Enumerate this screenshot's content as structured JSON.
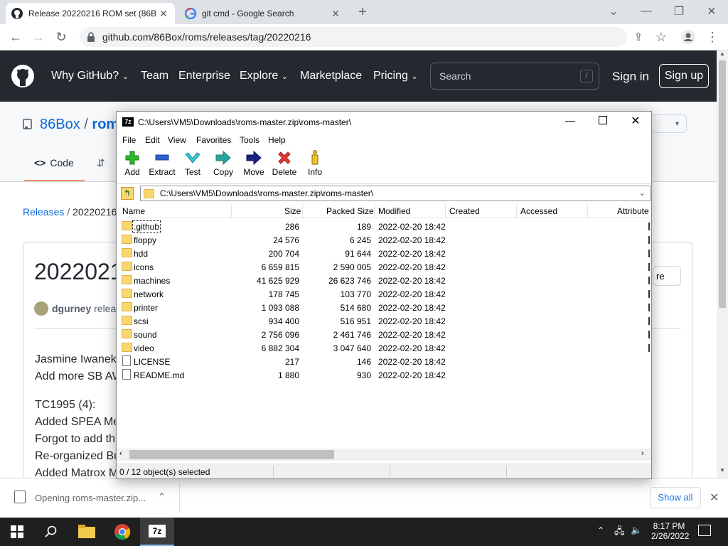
{
  "browser": {
    "tabs": [
      {
        "title": "Release 20220216 ROM set (86B",
        "active": true
      },
      {
        "title": "git cmd - Google Search",
        "active": false
      }
    ],
    "new_tab": "+",
    "url": "github.com/86Box/roms/releases/tag/20220216"
  },
  "github": {
    "nav": [
      "Why GitHub?",
      "Team",
      "Enterprise",
      "Explore",
      "Marketplace",
      "Pricing"
    ],
    "search_placeholder": "Search",
    "search_key": "/",
    "sign_in": "Sign in",
    "sign_up": "Sign up",
    "repo_owner": "86Box",
    "repo_sep": "/",
    "repo_name": "rom",
    "tab_code": "Code",
    "breadcrumb_releases": "Releases",
    "breadcrumb_sep": "/",
    "breadcrumb_tag": "20220216",
    "release_title": "2022021",
    "author": "dgurney",
    "author_suffix": "releas",
    "body_lines": [
      "Jasmine Iwanek",
      "Add more SB AW",
      "TC1995 (4):",
      "Added SPEA Me",
      "Forgot to add th",
      "Re-organized Bu",
      "Added Matrox M"
    ],
    "side_btn": "re"
  },
  "downloads": {
    "item": "Opening roms-master.zip...",
    "show_all": "Show all"
  },
  "taskbar": {
    "time": "8:17 PM",
    "date": "2/26/2022"
  },
  "zip": {
    "title": "C:\\Users\\VM5\\Downloads\\roms-master.zip\\roms-master\\",
    "menu": [
      "File",
      "Edit",
      "View",
      "Favorites",
      "Tools",
      "Help"
    ],
    "tools": [
      "Add",
      "Extract",
      "Test",
      "Copy",
      "Move",
      "Delete",
      "Info"
    ],
    "path": "C:\\Users\\VM5\\Downloads\\roms-master.zip\\roms-master\\",
    "columns": [
      "Name",
      "Size",
      "Packed Size",
      "Modified",
      "Created",
      "Accessed",
      "Attribute"
    ],
    "files": [
      {
        "name": ".github",
        "size": "286",
        "packed": "189",
        "modified": "2022-02-20 18:42",
        "type": "folder"
      },
      {
        "name": "floppy",
        "size": "24 576",
        "packed": "6 245",
        "modified": "2022-02-20 18:42",
        "type": "folder"
      },
      {
        "name": "hdd",
        "size": "200 704",
        "packed": "91 644",
        "modified": "2022-02-20 18:42",
        "type": "folder"
      },
      {
        "name": "icons",
        "size": "6 659 815",
        "packed": "2 590 005",
        "modified": "2022-02-20 18:42",
        "type": "folder"
      },
      {
        "name": "machines",
        "size": "41 625 929",
        "packed": "26 623 746",
        "modified": "2022-02-20 18:42",
        "type": "folder"
      },
      {
        "name": "network",
        "size": "178 745",
        "packed": "103 770",
        "modified": "2022-02-20 18:42",
        "type": "folder"
      },
      {
        "name": "printer",
        "size": "1 093 088",
        "packed": "514 680",
        "modified": "2022-02-20 18:42",
        "type": "folder"
      },
      {
        "name": "scsi",
        "size": "934 400",
        "packed": "516 951",
        "modified": "2022-02-20 18:42",
        "type": "folder"
      },
      {
        "name": "sound",
        "size": "2 756 096",
        "packed": "2 461 746",
        "modified": "2022-02-20 18:42",
        "type": "folder"
      },
      {
        "name": "video",
        "size": "6 882 304",
        "packed": "3 047 640",
        "modified": "2022-02-20 18:42",
        "type": "folder"
      },
      {
        "name": "LICENSE",
        "size": "217",
        "packed": "146",
        "modified": "2022-02-20 18:42",
        "type": "file"
      },
      {
        "name": "README.md",
        "size": "1 880",
        "packed": "930",
        "modified": "2022-02-20 18:42",
        "type": "file"
      }
    ],
    "status": "0 / 12 object(s) selected"
  }
}
